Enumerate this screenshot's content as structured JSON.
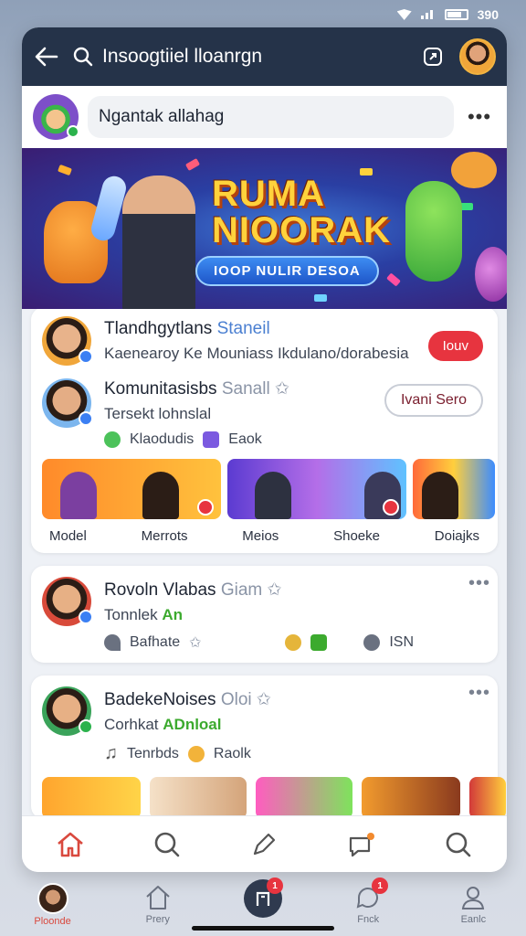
{
  "status_bar": {
    "time": "390"
  },
  "header": {
    "search_text": "Insoogtiiel lloanrgn",
    "icons": [
      "back-arrow-icon",
      "search-icon",
      "share-box-icon",
      "profile-avatar"
    ]
  },
  "composer": {
    "placeholder": "Ngantak allahag"
  },
  "banner": {
    "title_line1": "RUMA",
    "title_line2": "NIOORAK",
    "subtitle": "IOOP NULIR DESOA"
  },
  "feed_top": {
    "item1": {
      "name": "Tlandhgytlans",
      "tag": "Staneil",
      "desc": "Kaenearoy Ke Mouniass Ikdulano/dorabesia",
      "button": "Iouv"
    },
    "item2": {
      "name": "Komunitasisbs",
      "tag": "Sanall",
      "desc": "Tersekt lohnslal",
      "button": "Ivani Sero",
      "meta1": "Klaodudis",
      "meta2": "Eaok"
    },
    "thumb_labels": [
      "Model",
      "Merrots",
      "Meios",
      "Shoeke",
      "Doiajks"
    ]
  },
  "post1": {
    "name": "Rovoln Vlabas",
    "tag": "Giam",
    "sub": "Tonnlek",
    "sub_green": "An",
    "meta1": "Bafhate",
    "meta2": "ISN"
  },
  "post2": {
    "name": "BadekeNoises",
    "tag": "Oloi",
    "sub": "Corhkat",
    "sub_green": "ADnloal",
    "meta1": "Tenrbds",
    "meta2": "Raolk"
  },
  "bottom_nav": {
    "items": [
      "Ploonde",
      "Prery",
      "",
      "Fnck",
      "Eanlc"
    ],
    "badges": [
      "",
      "",
      "1",
      "1",
      ""
    ]
  },
  "colors": {
    "header_bg": "#253349",
    "accent_red": "#e7343f",
    "accent_blue": "#3b7ff3"
  }
}
